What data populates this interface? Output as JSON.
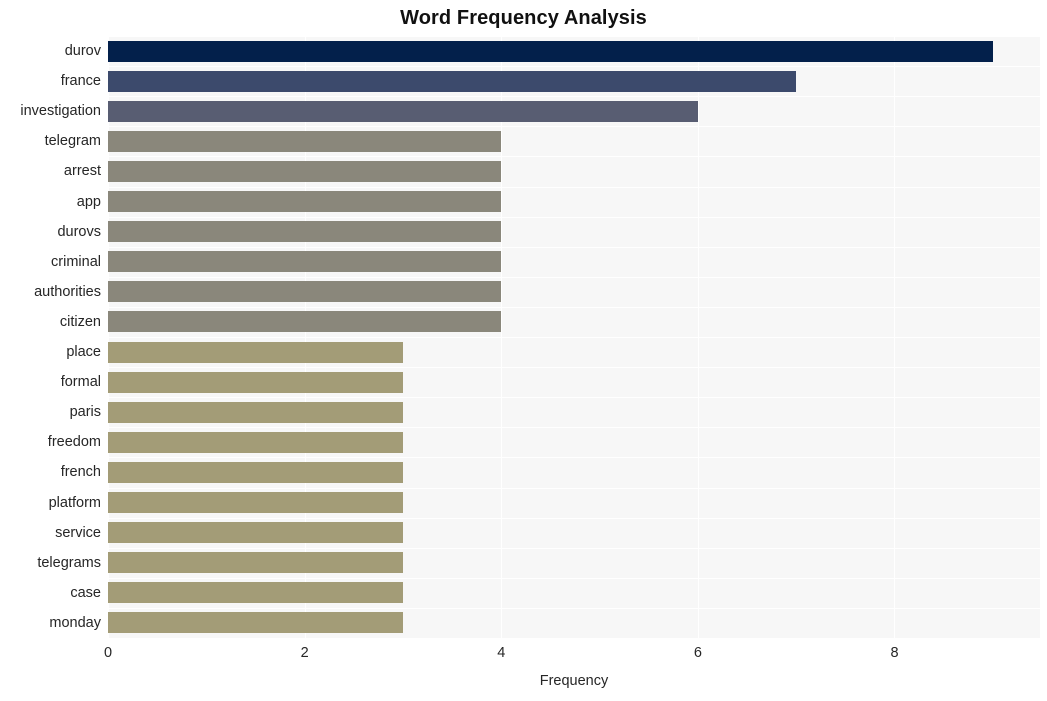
{
  "chart_data": {
    "type": "bar",
    "orientation": "horizontal",
    "title": "Word Frequency Analysis",
    "xlabel": "Frequency",
    "ylabel": "",
    "xlim": [
      0,
      9.48
    ],
    "xticks": [
      0,
      2,
      4,
      6,
      8
    ],
    "xtick_labels": [
      "0",
      "2",
      "4",
      "6",
      "8"
    ],
    "grid": true,
    "grid_color": "#ffffff",
    "plot_background": "#f7f7f7",
    "legend": null,
    "categories": [
      "durov",
      "france",
      "investigation",
      "telegram",
      "arrest",
      "app",
      "durovs",
      "criminal",
      "authorities",
      "citizen",
      "place",
      "formal",
      "paris",
      "freedom",
      "french",
      "platform",
      "service",
      "telegrams",
      "case",
      "monday"
    ],
    "values": [
      9,
      7,
      6,
      4,
      4,
      4,
      4,
      4,
      4,
      4,
      3,
      3,
      3,
      3,
      3,
      3,
      3,
      3,
      3,
      3
    ],
    "bar_colors": [
      "#03204b",
      "#3c4a6c",
      "#585d72",
      "#8a877b",
      "#8a877b",
      "#8a877b",
      "#8a877b",
      "#8a877b",
      "#8a877b",
      "#8a877b",
      "#a39c77",
      "#a39c77",
      "#a39c77",
      "#a39c77",
      "#a39c77",
      "#a39c77",
      "#a39c77",
      "#a39c77",
      "#a39c77",
      "#a39c77"
    ]
  }
}
